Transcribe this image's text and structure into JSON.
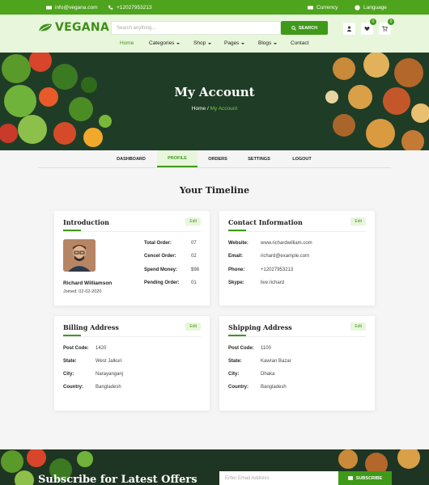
{
  "topbar": {
    "email": "info@vegana.com",
    "phone": "+12027953213",
    "currency": "Currency",
    "language": "Language"
  },
  "header": {
    "logo_text": "VEGANA",
    "search_placeholder": "Search anything...",
    "search_button": "SEARCH",
    "wishlist_count": "0",
    "cart_count": "0"
  },
  "nav": {
    "home": "Home",
    "categories": "Categories",
    "shop": "Shop",
    "pages": "Pages",
    "blogs": "Blogs",
    "contact": "Contact"
  },
  "hero": {
    "title": "My Account",
    "crumb_home": "Home",
    "crumb_sep": "/",
    "crumb_current": "My Account"
  },
  "tabs": [
    "DASHBOARD",
    "PROFILE",
    "ORDERS",
    "SETTINGS",
    "LOGOUT"
  ],
  "timeline_title": "Your Timeline",
  "edit_label": "Edit",
  "introduction": {
    "title": "Introduction",
    "name": "Richard Williamson",
    "joined": "Joined: 02-02-2020",
    "stats": [
      {
        "label": "Total Order:",
        "value": "07"
      },
      {
        "label": "Cencel Order:",
        "value": "02"
      },
      {
        "label": "Spend Money:",
        "value": "$98"
      },
      {
        "label": "Pending Order:",
        "value": "01"
      }
    ]
  },
  "contact": {
    "title": "Contact Information",
    "rows": [
      {
        "label": "Website:",
        "value": "www.richardwilliam.com"
      },
      {
        "label": "Email:",
        "value": "richard@example.com"
      },
      {
        "label": "Phone:",
        "value": "+12027953213"
      },
      {
        "label": "Skype:",
        "value": "live:richard"
      }
    ]
  },
  "billing": {
    "title": "Billing Address",
    "rows": [
      {
        "label": "Post Code:",
        "value": "1420"
      },
      {
        "label": "State:",
        "value": "West Jalkuri"
      },
      {
        "label": "City:",
        "value": "Narayanganj"
      },
      {
        "label": "Country:",
        "value": "Bangladesh"
      }
    ]
  },
  "shipping": {
    "title": "Shipping Address",
    "rows": [
      {
        "label": "Post Code:",
        "value": "1100"
      },
      {
        "label": "State:",
        "value": "Kawran Bazar"
      },
      {
        "label": "City:",
        "value": "Dhaka"
      },
      {
        "label": "Country:",
        "value": "Bangladesh"
      }
    ]
  },
  "subscribe": {
    "title": "Subscribe for Latest Offers",
    "email_placeholder": "Enter Email Address",
    "button": "SUBSCRIBE"
  },
  "colors": {
    "brand_green": "#4fa41e",
    "dark_green": "#3f9a1a",
    "light_green": "#e8f6dc"
  }
}
